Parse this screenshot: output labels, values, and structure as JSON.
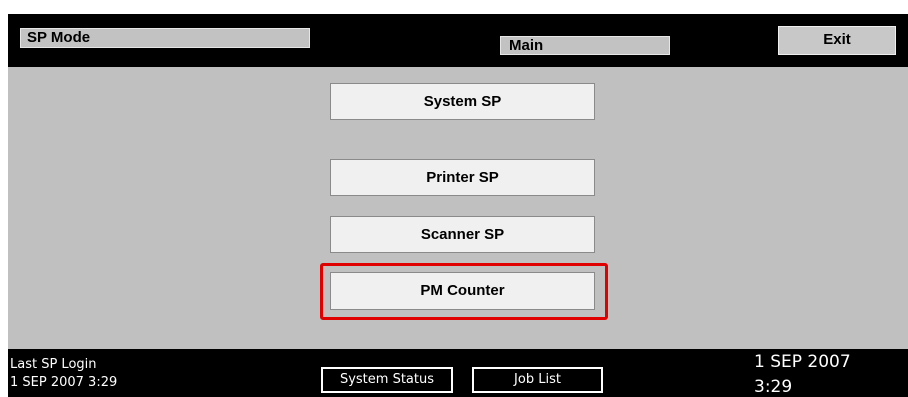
{
  "header": {
    "mode_title": "SP Mode",
    "screen_title": "Main",
    "exit_label": "Exit"
  },
  "menu": {
    "items": [
      {
        "label": "System SP"
      },
      {
        "label": "Printer SP"
      },
      {
        "label": "Scanner SP"
      },
      {
        "label": "PM Counter",
        "highlighted": true
      }
    ]
  },
  "footer": {
    "login_label": "Last SP Login",
    "login_time": "1 SEP 2007 3:29",
    "system_status_label": "System Status",
    "job_list_label": "Job List",
    "clock_date": "1 SEP 2007",
    "clock_time": "3:29"
  },
  "colors": {
    "highlight": "#e00000",
    "panel": "#c0c0c0",
    "frame": "#000000"
  }
}
